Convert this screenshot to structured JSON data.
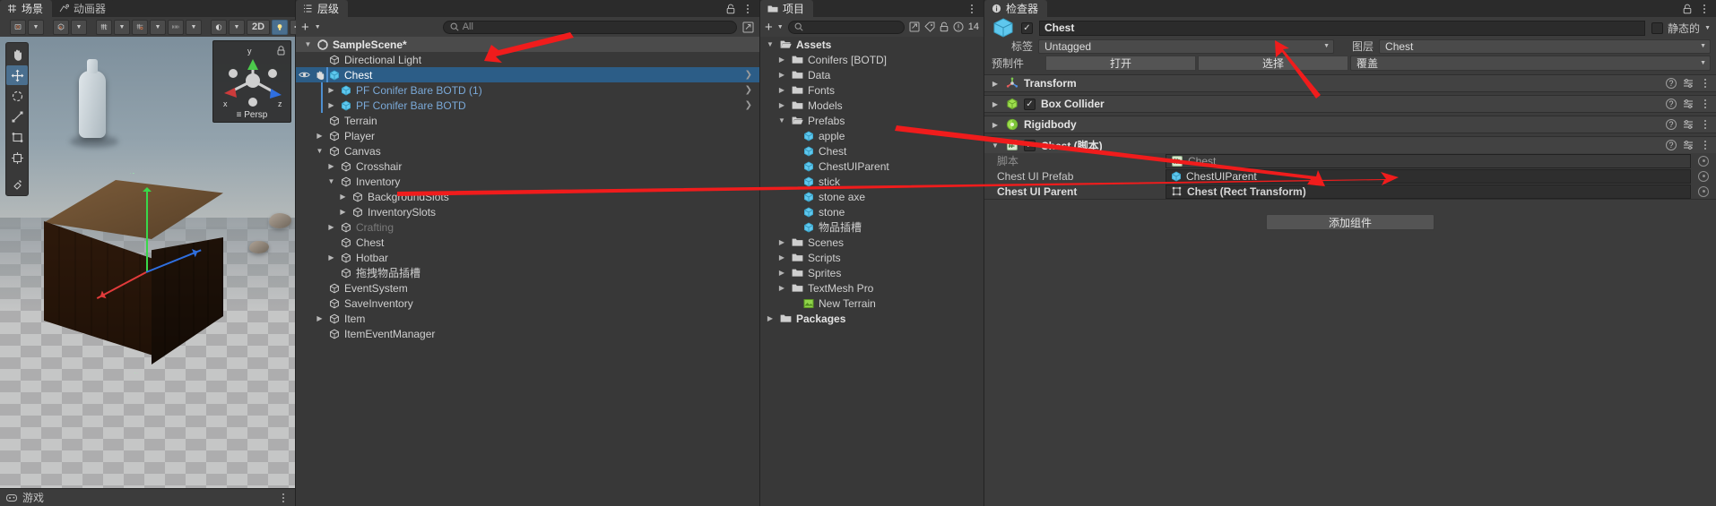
{
  "scene_view": {
    "tab_label": "场景",
    "tab2_label": "动画器",
    "toolbar": {
      "draw_mode": "着色",
      "twod_label": "2D",
      "light_icon": "lightbulb-icon",
      "audio_icon": "audio-mute-icon"
    },
    "gizmo": {
      "x_label": "x",
      "y_label": "y",
      "z_label": "z",
      "persp_label": "≡ Persp"
    },
    "footer_label": "游戏",
    "tools": [
      "hand-tool",
      "move-tool",
      "rotate-tool",
      "scale-tool",
      "rect-tool",
      "transform-tool",
      "custom-tool"
    ]
  },
  "hierarchy": {
    "tab_label": "层级",
    "search_placeholder": "All",
    "rows": [
      {
        "label": "SampleScene*",
        "indent": 0,
        "twisty": "down",
        "icon": "unity-scene-icon",
        "style": "scene"
      },
      {
        "label": "Directional Light",
        "indent": 1,
        "twisty": "none",
        "icon": "gameobject-icon",
        "style": "normal"
      },
      {
        "label": "Chest",
        "indent": 1,
        "twisty": "right",
        "icon": "prefab-icon",
        "style": "selected"
      },
      {
        "label": "PF Conifer Bare BOTD (1)",
        "indent": 2,
        "twisty": "right",
        "icon": "prefab-icon",
        "style": "prefab"
      },
      {
        "label": "PF Conifer Bare BOTD",
        "indent": 2,
        "twisty": "right",
        "icon": "prefab-icon",
        "style": "prefab"
      },
      {
        "label": "Terrain",
        "indent": 1,
        "twisty": "none",
        "icon": "gameobject-icon",
        "style": "normal"
      },
      {
        "label": "Player",
        "indent": 1,
        "twisty": "right",
        "icon": "gameobject-icon",
        "style": "normal"
      },
      {
        "label": "Canvas",
        "indent": 1,
        "twisty": "down",
        "icon": "gameobject-icon",
        "style": "normal"
      },
      {
        "label": "Crosshair",
        "indent": 2,
        "twisty": "right",
        "icon": "gameobject-icon",
        "style": "normal"
      },
      {
        "label": "Inventory",
        "indent": 2,
        "twisty": "down",
        "icon": "gameobject-icon",
        "style": "normal"
      },
      {
        "label": "BackgroundSlots",
        "indent": 3,
        "twisty": "right",
        "icon": "gameobject-icon",
        "style": "normal"
      },
      {
        "label": "InventorySlots",
        "indent": 3,
        "twisty": "right",
        "icon": "gameobject-icon",
        "style": "normal"
      },
      {
        "label": "Crafting",
        "indent": 2,
        "twisty": "right",
        "icon": "gameobject-icon",
        "style": "dimmed"
      },
      {
        "label": "Chest",
        "indent": 2,
        "twisty": "none",
        "icon": "gameobject-icon",
        "style": "normal"
      },
      {
        "label": "Hotbar",
        "indent": 2,
        "twisty": "right",
        "icon": "gameobject-icon",
        "style": "normal"
      },
      {
        "label": "拖拽物品插槽",
        "indent": 2,
        "twisty": "none",
        "icon": "gameobject-icon",
        "style": "normal"
      },
      {
        "label": "EventSystem",
        "indent": 1,
        "twisty": "none",
        "icon": "gameobject-icon",
        "style": "normal"
      },
      {
        "label": "SaveInventory",
        "indent": 1,
        "twisty": "none",
        "icon": "gameobject-icon",
        "style": "normal"
      },
      {
        "label": "Item",
        "indent": 1,
        "twisty": "right",
        "icon": "gameobject-icon",
        "style": "normal"
      },
      {
        "label": "ItemEventManager",
        "indent": 1,
        "twisty": "none",
        "icon": "gameobject-icon",
        "style": "normal"
      }
    ]
  },
  "project": {
    "tab_label": "项目",
    "badge_count": "14",
    "rows": [
      {
        "label": "Assets",
        "indent": 0,
        "twisty": "down",
        "icon": "folder-open-icon",
        "style": "bold"
      },
      {
        "label": "Conifers [BOTD]",
        "indent": 1,
        "twisty": "right",
        "icon": "folder-icon",
        "style": "normal"
      },
      {
        "label": "Data",
        "indent": 1,
        "twisty": "right",
        "icon": "folder-icon",
        "style": "normal"
      },
      {
        "label": "Fonts",
        "indent": 1,
        "twisty": "right",
        "icon": "folder-icon",
        "style": "normal"
      },
      {
        "label": "Models",
        "indent": 1,
        "twisty": "right",
        "icon": "folder-icon",
        "style": "normal"
      },
      {
        "label": "Prefabs",
        "indent": 1,
        "twisty": "down",
        "icon": "folder-open-icon",
        "style": "normal"
      },
      {
        "label": "apple",
        "indent": 2,
        "twisty": "none",
        "icon": "prefab-icon",
        "style": "normal"
      },
      {
        "label": "Chest",
        "indent": 2,
        "twisty": "none",
        "icon": "prefab-icon",
        "style": "normal"
      },
      {
        "label": "ChestUIParent",
        "indent": 2,
        "twisty": "none",
        "icon": "prefab-icon",
        "style": "normal"
      },
      {
        "label": "stick",
        "indent": 2,
        "twisty": "none",
        "icon": "prefab-icon",
        "style": "normal"
      },
      {
        "label": "stone axe",
        "indent": 2,
        "twisty": "none",
        "icon": "prefab-icon",
        "style": "normal"
      },
      {
        "label": "stone",
        "indent": 2,
        "twisty": "none",
        "icon": "prefab-icon",
        "style": "normal"
      },
      {
        "label": "物品插槽",
        "indent": 2,
        "twisty": "none",
        "icon": "prefab-icon",
        "style": "normal"
      },
      {
        "label": "Scenes",
        "indent": 1,
        "twisty": "right",
        "icon": "folder-icon",
        "style": "normal"
      },
      {
        "label": "Scripts",
        "indent": 1,
        "twisty": "right",
        "icon": "folder-icon",
        "style": "normal"
      },
      {
        "label": "Sprites",
        "indent": 1,
        "twisty": "right",
        "icon": "folder-icon",
        "style": "normal"
      },
      {
        "label": "TextMesh Pro",
        "indent": 1,
        "twisty": "right",
        "icon": "folder-icon",
        "style": "normal"
      },
      {
        "label": "New Terrain",
        "indent": 2,
        "twisty": "none",
        "icon": "terrain-icon",
        "style": "normal"
      },
      {
        "label": "Packages",
        "indent": 0,
        "twisty": "right",
        "icon": "folder-icon",
        "style": "bold"
      }
    ]
  },
  "inspector": {
    "tab_label": "检查器",
    "object_name": "Chest",
    "enabled": true,
    "static_label": "静态的",
    "tag_label": "标签",
    "tag_value": "Untagged",
    "layer_label": "图层",
    "layer_value": "Chest",
    "prefab_label": "预制件",
    "prefab_open": "打开",
    "prefab_select": "选择",
    "prefab_overrides": "覆盖",
    "components": [
      {
        "name": "Transform",
        "icon": "transform-icon",
        "has_checkbox": false,
        "expanded": false
      },
      {
        "name": "Box Collider",
        "icon": "box-collider-icon",
        "has_checkbox": true,
        "expanded": false
      },
      {
        "name": "Rigidbody",
        "icon": "rigidbody-icon",
        "has_checkbox": false,
        "expanded": false
      },
      {
        "name": "Chest  (脚本)",
        "icon": "script-icon",
        "has_checkbox": true,
        "expanded": true
      }
    ],
    "script_props": [
      {
        "label": "脚本",
        "value": "Chest",
        "icon": "script-icon",
        "dim": true,
        "bold": false
      },
      {
        "label": "Chest UI Prefab",
        "value": "ChestUIParent",
        "icon": "prefab-icon",
        "dim": false,
        "bold": false
      },
      {
        "label": "Chest UI Parent",
        "value": "Chest (Rect Transform)",
        "icon": "rect-transform-icon",
        "dim": false,
        "bold": true
      }
    ],
    "add_component_label": "添加组件"
  }
}
